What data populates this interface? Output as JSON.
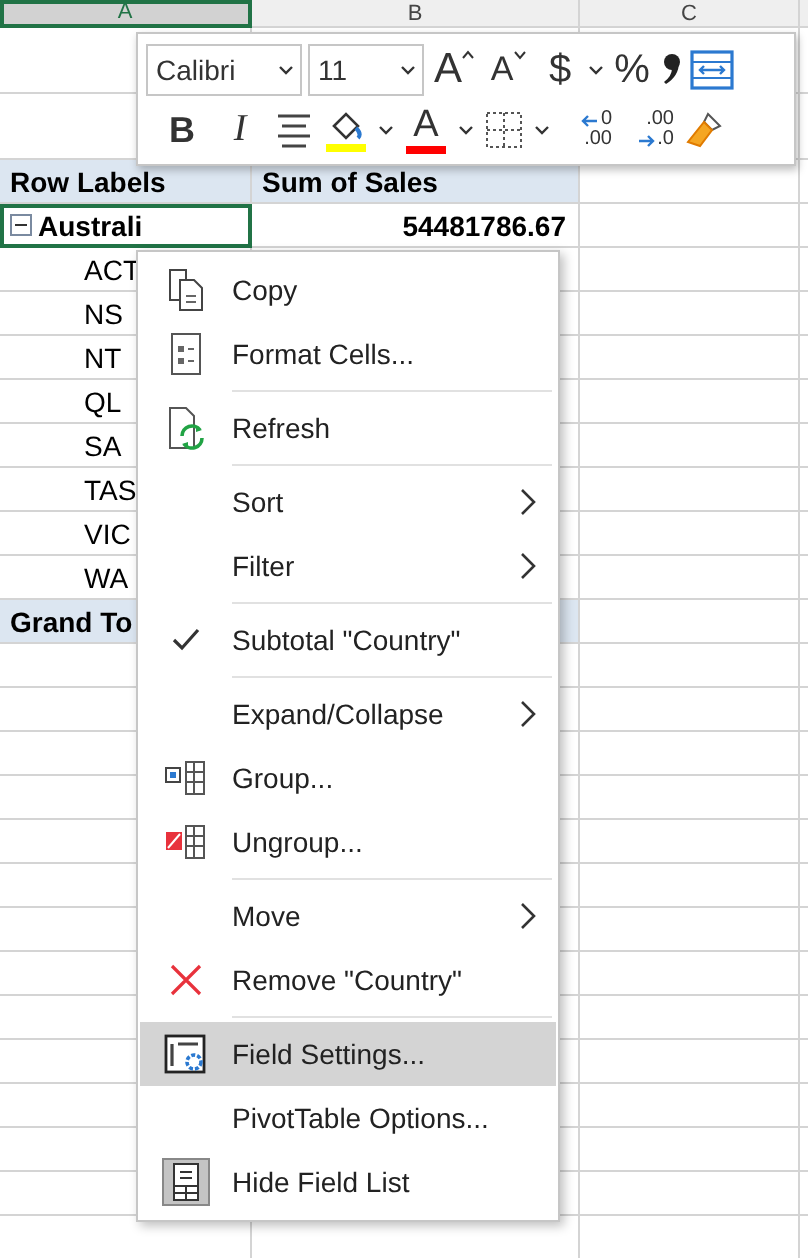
{
  "sheet": {
    "columns": [
      {
        "label": "A",
        "selected": true
      },
      {
        "label": "B",
        "selected": false
      },
      {
        "label": "C",
        "selected": false
      }
    ],
    "rows": [
      {
        "kind": "header",
        "selected": false,
        "cells": [
          "Row Labels",
          "Sum of Sales"
        ]
      },
      {
        "kind": "group",
        "selected": true,
        "expanded": true,
        "cells": [
          "Australi",
          "54481786.67"
        ]
      },
      {
        "kind": "item",
        "selected": false,
        "cells": [
          "ACT"
        ]
      },
      {
        "kind": "item",
        "selected": false,
        "cells": [
          "NS"
        ]
      },
      {
        "kind": "item",
        "selected": false,
        "cells": [
          "NT"
        ]
      },
      {
        "kind": "item",
        "selected": false,
        "cells": [
          "QL"
        ]
      },
      {
        "kind": "item",
        "selected": false,
        "cells": [
          "SA"
        ]
      },
      {
        "kind": "item",
        "selected": false,
        "cells": [
          "TAS"
        ]
      },
      {
        "kind": "item",
        "selected": false,
        "cells": [
          "VIC"
        ]
      },
      {
        "kind": "item",
        "selected": false,
        "cells": [
          "WA"
        ]
      },
      {
        "kind": "total",
        "selected": false,
        "cells": [
          "Grand To"
        ]
      }
    ]
  },
  "mini_toolbar": {
    "rows": [
      [
        {
          "kind": "select",
          "value": "Calibri"
        },
        {
          "kind": "select",
          "value": "11"
        },
        {
          "kind": "grow",
          "label": "A"
        },
        {
          "kind": "shrink",
          "label": "A"
        },
        {
          "kind": "text",
          "label": "$"
        },
        {
          "kind": "caret"
        },
        {
          "kind": "text",
          "label": "%"
        },
        {
          "kind": "comma"
        },
        {
          "kind": "wrap"
        }
      ],
      [
        {
          "kind": "bold",
          "label": "B"
        },
        {
          "kind": "italic",
          "label": "I"
        },
        {
          "kind": "align"
        },
        {
          "kind": "fill",
          "color": "#ffff00"
        },
        {
          "kind": "caret"
        },
        {
          "kind": "font_color",
          "label": "A",
          "color": "#ff0000"
        },
        {
          "kind": "caret"
        },
        {
          "kind": "borders"
        },
        {
          "kind": "caret"
        },
        {
          "kind": "inc_decimal",
          "labels": [
            "0",
            ".00"
          ]
        },
        {
          "kind": "dec_decimal",
          "labels": [
            ".00",
            ".0"
          ]
        },
        {
          "kind": "painter"
        }
      ]
    ]
  },
  "context_menu": {
    "groups": [
      [
        {
          "kind": "copy",
          "label": "Copy",
          "checked": false,
          "submenu": false,
          "selected": false
        },
        {
          "kind": "format_cells",
          "label": "Format Cells...",
          "checked": false,
          "submenu": false,
          "selected": false
        }
      ],
      [
        {
          "kind": "refresh",
          "label": "Refresh",
          "checked": false,
          "submenu": false,
          "selected": false
        }
      ],
      [
        {
          "kind": "plain",
          "label": "Sort",
          "checked": false,
          "submenu": true,
          "selected": false
        },
        {
          "kind": "plain",
          "label": "Filter",
          "checked": false,
          "submenu": true,
          "selected": false
        }
      ],
      [
        {
          "kind": "plain",
          "label": "Subtotal \"Country\"",
          "checked": true,
          "submenu": false,
          "selected": false
        }
      ],
      [
        {
          "kind": "plain",
          "label": "Expand/Collapse",
          "checked": false,
          "submenu": true,
          "selected": false
        },
        {
          "kind": "group",
          "label": "Group...",
          "checked": false,
          "submenu": false,
          "selected": false
        },
        {
          "kind": "ungroup",
          "label": "Ungroup...",
          "checked": false,
          "submenu": false,
          "selected": false
        }
      ],
      [
        {
          "kind": "plain",
          "label": "Move",
          "checked": false,
          "submenu": true,
          "selected": false
        },
        {
          "kind": "remove",
          "label": "Remove \"Country\"",
          "checked": false,
          "submenu": false,
          "selected": false
        }
      ],
      [
        {
          "kind": "field_settings",
          "label": "Field Settings...",
          "checked": false,
          "submenu": false,
          "selected": true
        },
        {
          "kind": "plain",
          "label": "PivotTable Options...",
          "checked": false,
          "submenu": false,
          "selected": false
        },
        {
          "kind": "field_list",
          "label": "Hide Field List",
          "checked": false,
          "submenu": false,
          "selected": false
        }
      ]
    ]
  }
}
